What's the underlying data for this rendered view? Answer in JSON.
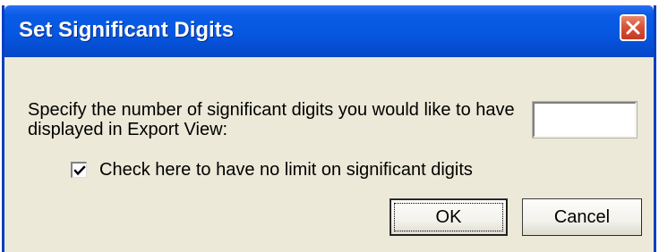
{
  "dialog": {
    "title": "Set Significant Digits",
    "prompt": "Specify the number of significant digits you would like to have displayed in Export View:",
    "digits_value": "",
    "checkbox_label": "Check here to have no limit on significant digits",
    "checkbox_checked": true,
    "ok_label": "OK",
    "cancel_label": "Cancel"
  },
  "icons": {
    "close": "close-icon",
    "check": "checkmark-icon"
  },
  "colors": {
    "titlebar": "#0657e0",
    "close_button": "#d8533a",
    "dialog_background": "#ece9d8"
  }
}
